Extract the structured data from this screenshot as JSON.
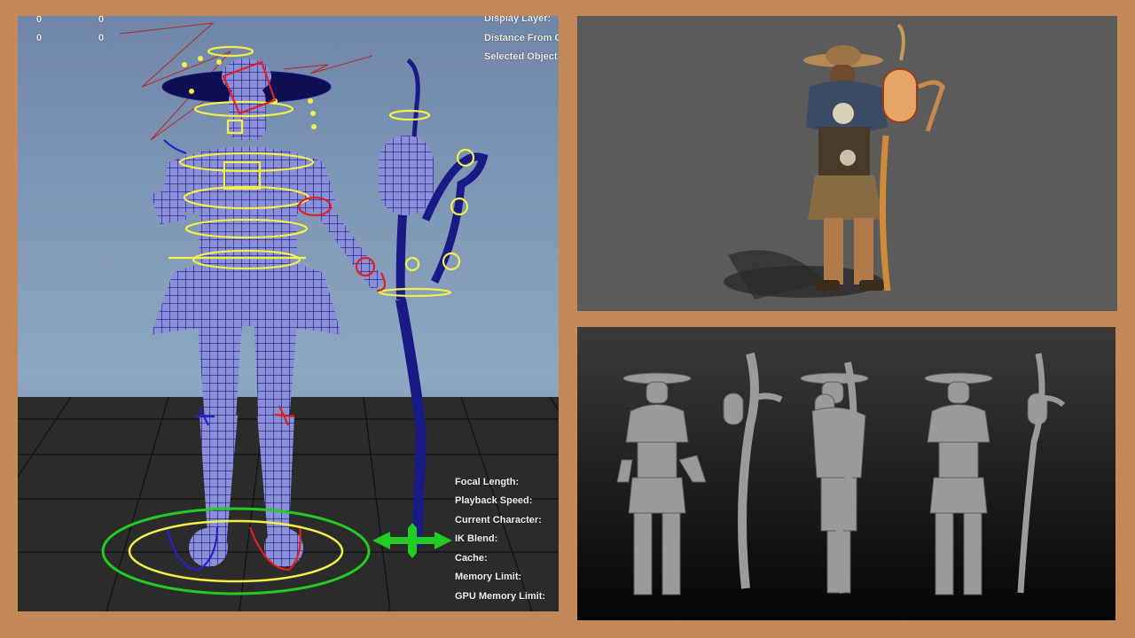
{
  "viewport": {
    "hud_top_left": {
      "row1": [
        "0",
        "0"
      ],
      "row2": [
        "0",
        "0"
      ]
    },
    "hud_top_right": [
      "Display Layer:",
      "Distance From C",
      "Selected Object"
    ],
    "hud_bottom_right": [
      "Focal Length:",
      "Playback Speed:",
      "Current Character:",
      "IK Blend:",
      "Cache:",
      "Memory Limit:",
      "GPU Memory Limit:"
    ],
    "colors": {
      "wire": "#1a1a86",
      "control_yellow": "#f4f04a",
      "control_red": "#e02020",
      "control_blue": "#2222cc",
      "control_green": "#22cc22"
    }
  },
  "render_panel": {
    "subject": "textured character with lantern staff"
  },
  "sculpt_panel": {
    "views": [
      "front-character",
      "staff-side",
      "side-character",
      "back-character"
    ]
  },
  "background_color": "#c38a58"
}
